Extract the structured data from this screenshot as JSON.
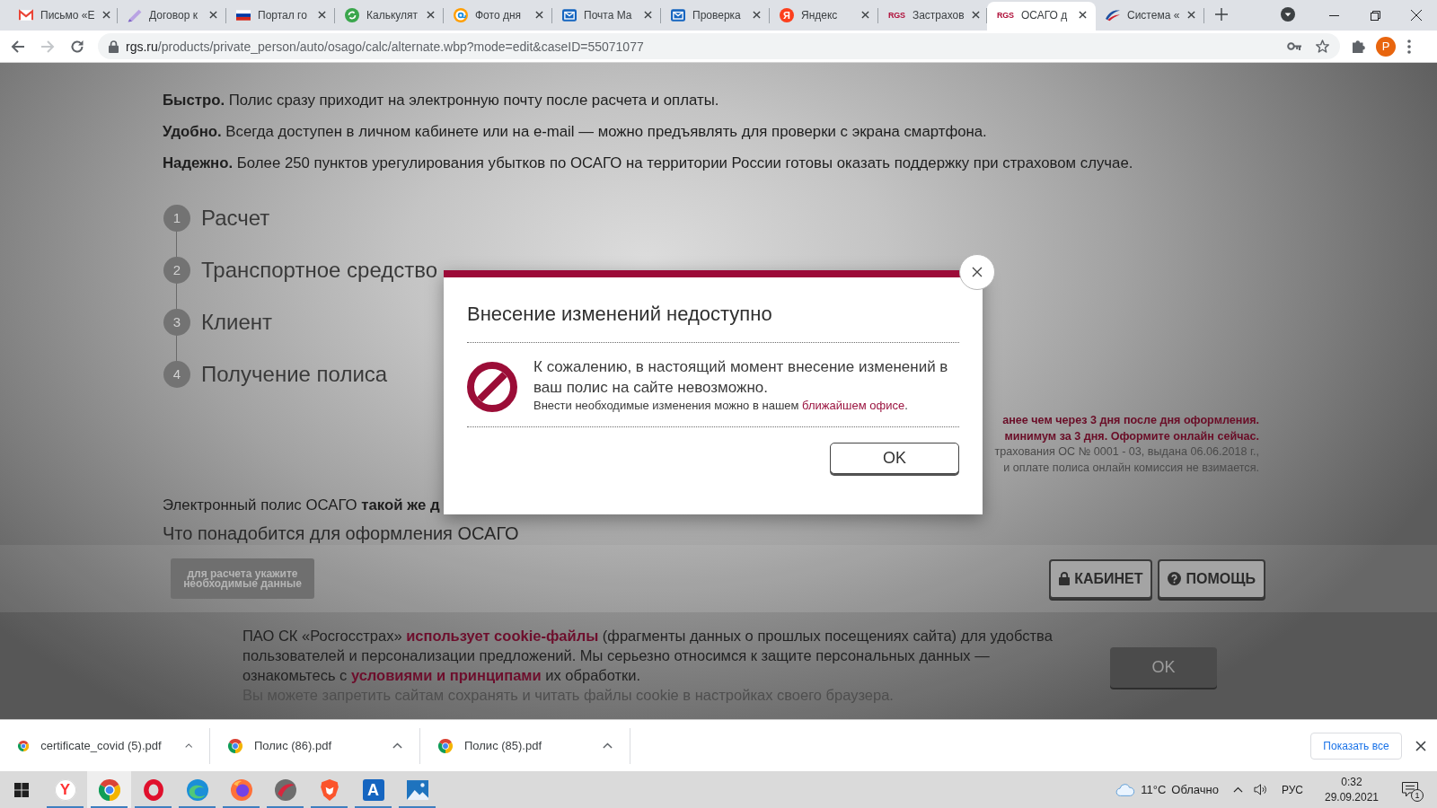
{
  "browser": {
    "tabs": [
      {
        "title": "Письмо «Е",
        "kind": "mail",
        "selected": false
      },
      {
        "title": "Договор к",
        "kind": "pen",
        "selected": false
      },
      {
        "title": "Портал го",
        "kind": "flag",
        "selected": false
      },
      {
        "title": "Калькулят",
        "kind": "cycle",
        "selected": false
      },
      {
        "title": "Фото дня",
        "kind": "at",
        "selected": false
      },
      {
        "title": "Почта Ма",
        "kind": "envelope",
        "selected": false
      },
      {
        "title": "Проверка",
        "kind": "envelope",
        "selected": false
      },
      {
        "title": "Яндекс",
        "kind": "round-logo",
        "logo": "Я",
        "selected": false
      },
      {
        "title": "Застрахов",
        "kind": "text-logo",
        "logo": "RGS",
        "selected": false
      },
      {
        "title": "ОСАГО д",
        "kind": "text-logo",
        "logo": "RGS",
        "selected": true
      },
      {
        "title": "Система «",
        "kind": "swoosh",
        "selected": false
      }
    ],
    "nav_buttons": [
      {
        "kind": "back",
        "disabled": false
      },
      {
        "kind": "forward",
        "disabled": true
      },
      {
        "kind": "reload",
        "disabled": false
      }
    ],
    "address": {
      "host": "rgs.ru",
      "path": "/products/private_person/auto/osago/calc/alternate.wbp?mode=edit&caseID=55071077"
    },
    "profile": {
      "initial": "P"
    }
  },
  "page": {
    "features": [
      {
        "text": "**Быстро.** Полис сразу приходит на электронную почту после расчета и оплаты."
      },
      {
        "text": "**Удобно.** Всегда доступен в личном кабинете или на e-mail — можно предъявлять для проверки с экрана смартфона."
      },
      {
        "text": "**Надежно.** Более 250 пунктов урегулирования убытков по ОСАГО на территории России готовы оказать поддержку при страховом случае."
      }
    ],
    "steps": [
      {
        "number": "1",
        "label": "Расчет"
      },
      {
        "number": "2",
        "label": "Транспортное средство"
      },
      {
        "number": "3",
        "label": "Клиент"
      },
      {
        "number": "4",
        "label": "Получение полиса"
      }
    ],
    "side_notes": [
      {
        "text": "анее чем через 3 дня после дня оформления.",
        "kind": "accent"
      },
      {
        "text": "минимум за 3 дня. Оформите онлайн сейчас.",
        "kind": "accent"
      },
      {
        "text": "трахования ОС № 0001 - 03, выдана 06.06.2018 г.,",
        "kind": "plain"
      },
      {
        "text": "и оплате полиса онлайн комиссия не взимается.",
        "kind": "plain"
      }
    ],
    "notice": "Электронный полис ОСАГО **такой же д**",
    "heading": "Что понадобится для оформления ОСАГО"
  },
  "dialog": {
    "title": "Внесение изменений недоступно",
    "message": "К сожалению, в настоящий момент внесение изменений в ваш полис на сайте невозможно.",
    "hint": [
      {
        "text": "Внести необходимые изменения можно в нашем ",
        "link": false
      },
      {
        "text": "ближайшем офисе",
        "link": true
      },
      {
        "text": ".",
        "link": false
      }
    ],
    "button": "OK"
  },
  "action_bar": {
    "hint_button": {
      "label": "для расчета укажите необходимые данные",
      "disabled": true
    },
    "buttons": [
      {
        "label": "КАБИНЕТ",
        "kind": "lock"
      },
      {
        "label": "ПОМОЩЬ",
        "kind": "help"
      }
    ]
  },
  "cookie_banner": {
    "segments": [
      {
        "text": "ПАО СК «Росгосстрах» ",
        "link": false
      },
      {
        "text": "использует cookie-файлы",
        "link": true
      },
      {
        "text": " (фрагменты данных о прошлых посещениях сайта) для удобства пользователей и персонализации предложений. Мы серьезно относимся к защите персональных данных — ознакомьтесь с ",
        "link": false
      },
      {
        "text": "условиями и принципами",
        "link": true
      },
      {
        "text": " их обработки.",
        "link": false
      }
    ],
    "note": "Вы можете запретить сайтам сохранять и читать файлы cookie в настройках своего браузера.",
    "button": "OK"
  },
  "downloads": {
    "items": [
      {
        "name": "certificate_covid (5).pdf"
      },
      {
        "name": "Полис (86).pdf"
      },
      {
        "name": "Полис (85).pdf"
      }
    ],
    "show_all": "Показать все"
  },
  "taskbar": {
    "apps": [
      {
        "kind": "letter-round",
        "glyph": "Y",
        "running": true,
        "selected": false
      },
      {
        "kind": "chrome",
        "running": true,
        "selected": true
      },
      {
        "kind": "ring",
        "running": true,
        "selected": false
      },
      {
        "kind": "swirl",
        "running": true,
        "selected": false
      },
      {
        "kind": "fox",
        "running": true,
        "selected": false
      },
      {
        "kind": "disc",
        "running": true,
        "selected": false
      },
      {
        "kind": "shield",
        "running": true,
        "selected": false
      },
      {
        "kind": "letter-tile",
        "glyph": "A",
        "running": true,
        "selected": false
      },
      {
        "kind": "photo",
        "running": true,
        "selected": false
      }
    ],
    "weather": {
      "temperature": "11°C",
      "condition": "Облачно"
    },
    "language": "РУС",
    "time": "0:32",
    "date": "29.09.2021",
    "notifications": "1"
  }
}
